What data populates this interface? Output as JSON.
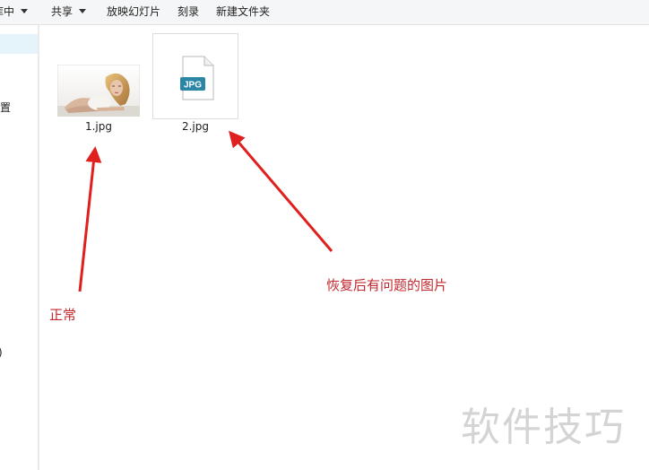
{
  "toolbar": {
    "items": [
      {
        "label": "库中",
        "has_dropdown": true
      },
      {
        "label": "共享",
        "has_dropdown": true
      },
      {
        "label": "放映幻灯片",
        "has_dropdown": false
      },
      {
        "label": "刻录",
        "has_dropdown": false
      },
      {
        "label": "新建文件夹",
        "has_dropdown": false
      }
    ]
  },
  "sidebar": {
    "items": [
      {
        "label": "位置"
      },
      {
        "label": ")"
      }
    ]
  },
  "files": [
    {
      "name": "1.jpg",
      "thumbnail": "photo"
    },
    {
      "name": "2.jpg",
      "thumbnail": "generic-jpg-icon",
      "icon_badge": "JPG"
    }
  ],
  "annotations": {
    "normal_label": "正常",
    "problem_label": "恢复后有问题的图片",
    "color": "#c0292e"
  },
  "arrow_color": "#e0201f",
  "watermark": {
    "text": "软件技巧",
    "color": "#d4d4d4"
  }
}
